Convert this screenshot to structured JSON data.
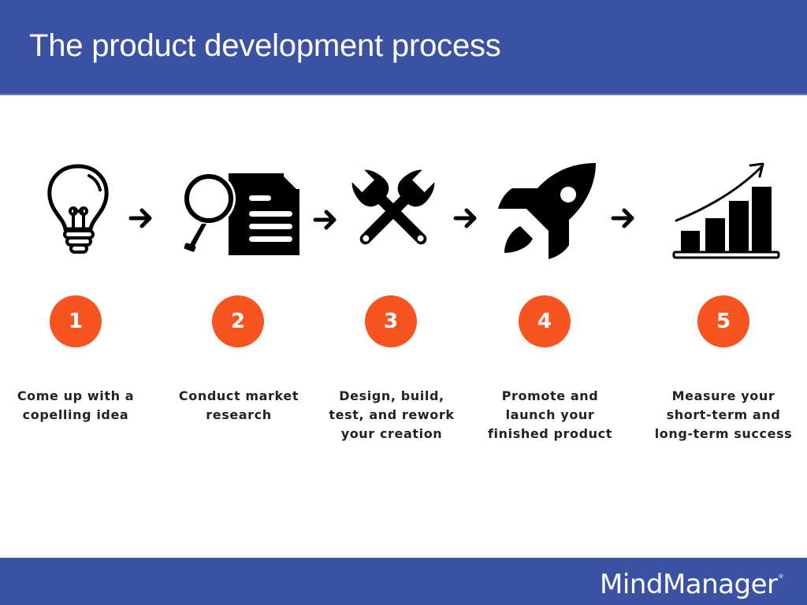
{
  "header": {
    "title": "The product development process",
    "background_color": "#3b52a4"
  },
  "steps": [
    {
      "number": "1",
      "icon": "lightbulb-icon",
      "caption_lines": [
        "Come up with a",
        "copelling idea"
      ]
    },
    {
      "number": "2",
      "icon": "magnifier-document-icon",
      "caption_lines": [
        "Conduct market",
        "research"
      ]
    },
    {
      "number": "3",
      "icon": "crossed-wrenches-icon",
      "caption_lines": [
        "Design, build,",
        "test, and rework",
        "your creation"
      ]
    },
    {
      "number": "4",
      "icon": "rocket-icon",
      "caption_lines": [
        "Promote and",
        "launch your",
        "finished product"
      ]
    },
    {
      "number": "5",
      "icon": "growth-bar-chart-icon",
      "caption_lines": [
        "Measure your",
        "short-term and",
        "long-term success"
      ]
    }
  ],
  "connector_icon": "arrow-right-icon",
  "badge_color": "#f7541f",
  "footer": {
    "logo_text": "MindManager",
    "logo_mark": "®"
  }
}
